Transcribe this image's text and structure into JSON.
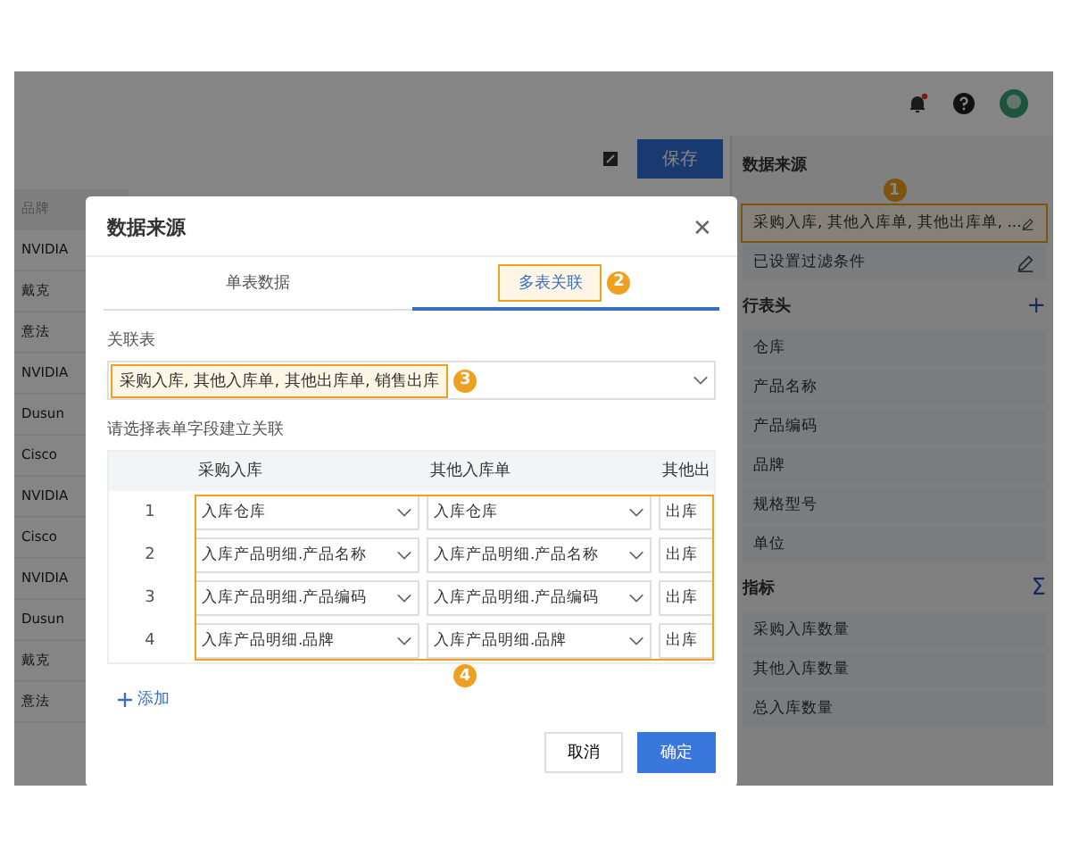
{
  "toolbar": {
    "save_button": "保存"
  },
  "background_table": {
    "header": "品牌",
    "rows": [
      "NVIDIA",
      "戴克",
      "意法",
      "NVIDIA",
      "Dusun",
      "Cisco",
      "NVIDIA",
      "Cisco",
      "NVIDIA",
      "Dusun",
      "戴克",
      "意法"
    ]
  },
  "side_panel": {
    "sections": [
      {
        "title": "数据来源",
        "items": [
          {
            "label": "采购入库, 其他入库单, 其他出库单, ...",
            "kind": "editable",
            "callout": "1"
          },
          {
            "label": "已设置过滤条件",
            "kind": "editable"
          }
        ]
      },
      {
        "title": "行表头",
        "action": "+",
        "items": [
          {
            "label": "仓库",
            "kind": "plain"
          },
          {
            "label": "产品名称",
            "kind": "plain"
          },
          {
            "label": "产品编码",
            "kind": "plain"
          },
          {
            "label": "品牌",
            "kind": "plain"
          },
          {
            "label": "规格型号",
            "kind": "plain"
          },
          {
            "label": "单位",
            "kind": "plain"
          }
        ]
      },
      {
        "title": "指标",
        "action": "Σ",
        "items": [
          {
            "label": "采购入库数量",
            "kind": "plain"
          },
          {
            "label": "其他入库数量",
            "kind": "plain"
          },
          {
            "label": "总入库数量",
            "kind": "plain"
          }
        ]
      }
    ]
  },
  "dialog": {
    "title": "数据来源",
    "close": "✕",
    "tabs": [
      {
        "label": "单表数据",
        "selected": false
      },
      {
        "label": "多表关联",
        "selected": true,
        "callout": "2"
      }
    ],
    "linked_tables": {
      "label": "关联表",
      "value": "采购入库, 其他入库单, 其他出库单, 销售出库",
      "callout": "3"
    },
    "hint": "请选择表单字段建立关联",
    "mapping_table": {
      "columns": [
        "采购入库",
        "其他入库单",
        "其他出"
      ],
      "callout": "4",
      "rows": [
        {
          "index": "1",
          "cells": [
            "入库仓库",
            "入库仓库",
            "出库"
          ]
        },
        {
          "index": "2",
          "cells": [
            "入库产品明细.产品名称",
            "入库产品明细.产品名称",
            "出库"
          ]
        },
        {
          "index": "3",
          "cells": [
            "入库产品明细.产品编码",
            "入库产品明细.产品编码",
            "出库"
          ]
        },
        {
          "index": "4",
          "cells": [
            "入库产品明细.品牌",
            "入库产品明细.品牌",
            "出库"
          ]
        }
      ]
    },
    "add_link": "添加",
    "buttons": [
      {
        "label": "取消",
        "kind": "secondary"
      },
      {
        "label": "确定",
        "kind": "primary"
      }
    ]
  }
}
